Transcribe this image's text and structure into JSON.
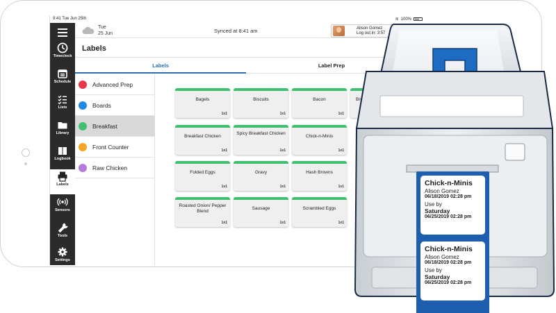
{
  "status_bar": {
    "left": "9:41 Tue Jun 25th",
    "right": "100%"
  },
  "header": {
    "weather": {
      "day": "Tue",
      "date": "25 Jun",
      "icon": "cloud-icon"
    },
    "sync_text": "Synced at 8:41 am",
    "user": {
      "name": "Alison Gomez",
      "logout": "Log out in: 3:57"
    }
  },
  "page_title": "Labels",
  "tabs": [
    {
      "label": "Labels"
    },
    {
      "label": "Label Prep"
    }
  ],
  "nav": [
    {
      "label": "Timeclock",
      "icon": "clock-icon"
    },
    {
      "label": "Schedule",
      "icon": "calendar-icon"
    },
    {
      "label": "Lists",
      "icon": "checklist-icon"
    },
    {
      "label": "Library",
      "icon": "folder-icon"
    },
    {
      "label": "Logbook",
      "icon": "book-icon"
    },
    {
      "label": "Labels",
      "icon": "printer-icon"
    },
    {
      "label": "Sensors",
      "icon": "signal-icon"
    },
    {
      "label": "Tools",
      "icon": "wrench-icon"
    },
    {
      "label": "Settings",
      "icon": "gear-icon"
    }
  ],
  "categories": [
    {
      "name": "Advanced Prep",
      "color": "#e8394a"
    },
    {
      "name": "Boards",
      "color": "#1e88e5"
    },
    {
      "name": "Breakfast",
      "color": "#3fbf6f"
    },
    {
      "name": "Front Counter",
      "color": "#f5a623"
    },
    {
      "name": "Raw Chicken",
      "color": "#b57bde"
    }
  ],
  "labels": [
    {
      "name": "Bagels",
      "size": "1x1"
    },
    {
      "name": "Biscuits",
      "size": "1x1"
    },
    {
      "name": "Bacon",
      "size": "1x1"
    },
    {
      "name": "Bre",
      "size": ""
    },
    {
      "name": "Breakfast Chicken",
      "size": "1x1"
    },
    {
      "name": "Spicy Breakfast Chicken",
      "size": "1x1"
    },
    {
      "name": "Chick-n-Minis",
      "size": "1x1"
    },
    {
      "name": "Folded Eggs",
      "size": "1x1"
    },
    {
      "name": "Gravy",
      "size": "1x1"
    },
    {
      "name": "Hash Browns",
      "size": "1x1"
    },
    {
      "name": "Roasted Onion/ Pepper Blend",
      "size": "1x1"
    },
    {
      "name": "Sausage",
      "size": "1x1"
    },
    {
      "name": "Scrambled Eggs",
      "size": "1x1"
    }
  ],
  "printed_labels": [
    {
      "title": "Chick-n-Minis",
      "employee": "Alison Gomez",
      "printed": "06/18/2019 02:28 pm",
      "use_by": "Use by",
      "day": "Saturday",
      "expires": "06/25/2019 02:28 pm"
    },
    {
      "title": "Chick-n-Minis",
      "employee": "Alison Gomez",
      "printed": "06/18/2019 02:28 pm",
      "use_by": "Use by",
      "day": "Saturday",
      "expires": "06/25/2019 02:28 pm"
    }
  ]
}
